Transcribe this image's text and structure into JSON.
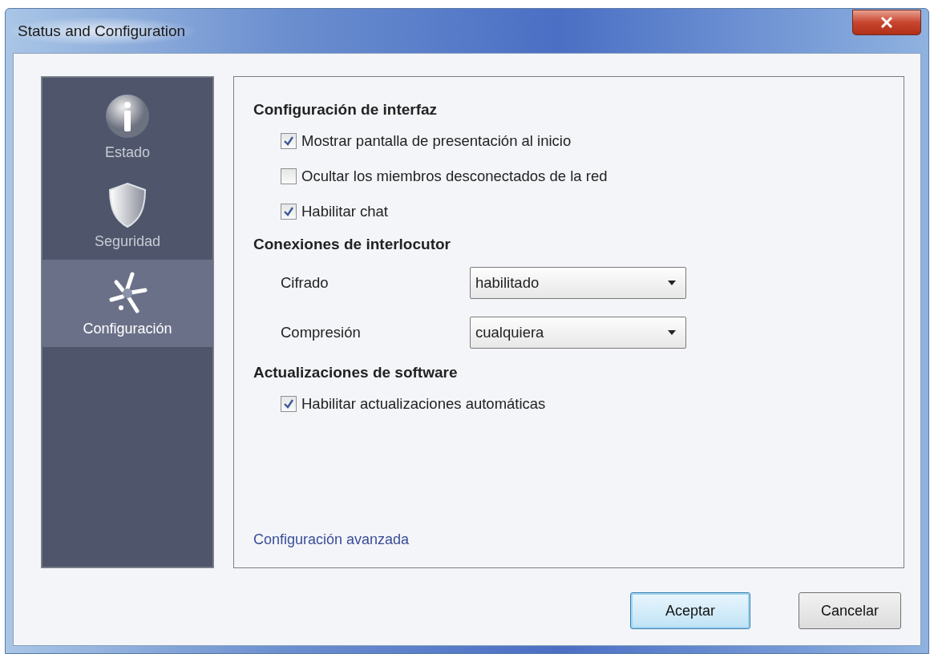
{
  "window": {
    "title": "Status and Configuration"
  },
  "sidebar": {
    "items": [
      {
        "kind": "info",
        "label": "Estado",
        "selected": false
      },
      {
        "kind": "shield",
        "label": "Seguridad",
        "selected": false
      },
      {
        "kind": "gear",
        "label": "Configuración",
        "selected": true
      }
    ]
  },
  "sections": [
    {
      "heading": "Configuración de interfaz",
      "rows": [
        {
          "kind": "checkbox",
          "label": "Mostrar pantalla de presentación al inicio",
          "checked": true
        },
        {
          "kind": "checkbox",
          "label": "Ocultar los miembros desconectados de la red",
          "checked": false
        },
        {
          "kind": "checkbox",
          "label": "Habilitar chat",
          "checked": true
        }
      ]
    },
    {
      "heading": "Conexiones de interlocutor",
      "rows": [
        {
          "kind": "dropdown",
          "label": "Cifrado",
          "value": "habilitado"
        },
        {
          "kind": "dropdown",
          "label": "Compresión",
          "value": "cualquiera"
        }
      ]
    },
    {
      "heading": "Actualizaciones de software",
      "rows": [
        {
          "kind": "checkbox",
          "label": "Habilitar actualizaciones automáticas",
          "checked": true
        }
      ]
    }
  ],
  "link": "Configuración avanzada",
  "buttons": [
    {
      "label": "Aceptar",
      "default": true
    },
    {
      "label": "Cancelar",
      "default": false
    }
  ]
}
